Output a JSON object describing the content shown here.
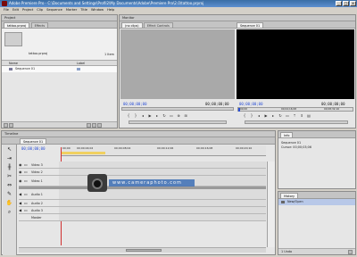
{
  "window": {
    "title": "Adobe Premiere Pro - C:\\Documents and Settings\\Profil2\\My Documents\\Adobe\\Premiere Pro\\2.0\\tattoo.prproj",
    "min_label": "_",
    "max_label": "□",
    "close_label": "x"
  },
  "menu": [
    "File",
    "Edit",
    "Project",
    "Clip",
    "Sequence",
    "Marker",
    "Title",
    "Window",
    "Help"
  ],
  "project": {
    "title": "Project",
    "tabs": [
      "tattoo.prproj",
      "Effects"
    ],
    "name_field": "tattoo.prproj",
    "item_count": "1 Item",
    "col_name": "Name",
    "col_label": "Label",
    "items": [
      "Sequence 01"
    ]
  },
  "monitor": {
    "title": "Monitor",
    "source_tabs": [
      "(no clips)",
      "Effect Controls"
    ],
    "program_tab": "Sequence 01",
    "source_tc_left": "00;00;00;00",
    "source_tc_right": "00;00;00;00",
    "program_tc_left": "00;00;00;00",
    "program_tc_right": "00;00;00;00",
    "program_ruler": [
      "00;00",
      "00;04;16;08",
      "00;08;32;16"
    ]
  },
  "timeline": {
    "title": "Timeline",
    "tab": "Sequence 01",
    "timecode": "00;00;00;00",
    "ruler": [
      "00;00",
      "00;00;04;02",
      "00;00;08;04",
      "00;00;12;06",
      "00;00;16;08",
      "00;00;20;10"
    ],
    "tracks": [
      "Video 3",
      "Video 2",
      "Video 1",
      "Audio 1",
      "Audio 2",
      "Audio 3"
    ],
    "master": "Master"
  },
  "info": {
    "tab": "Info",
    "lines": [
      "Sequence 01",
      "Cursor: 00;00;03;06"
    ]
  },
  "history": {
    "tab": "History",
    "items": [
      "New/Open"
    ],
    "status": "1 Undo"
  },
  "watermark": "www.cameraphoto.com"
}
